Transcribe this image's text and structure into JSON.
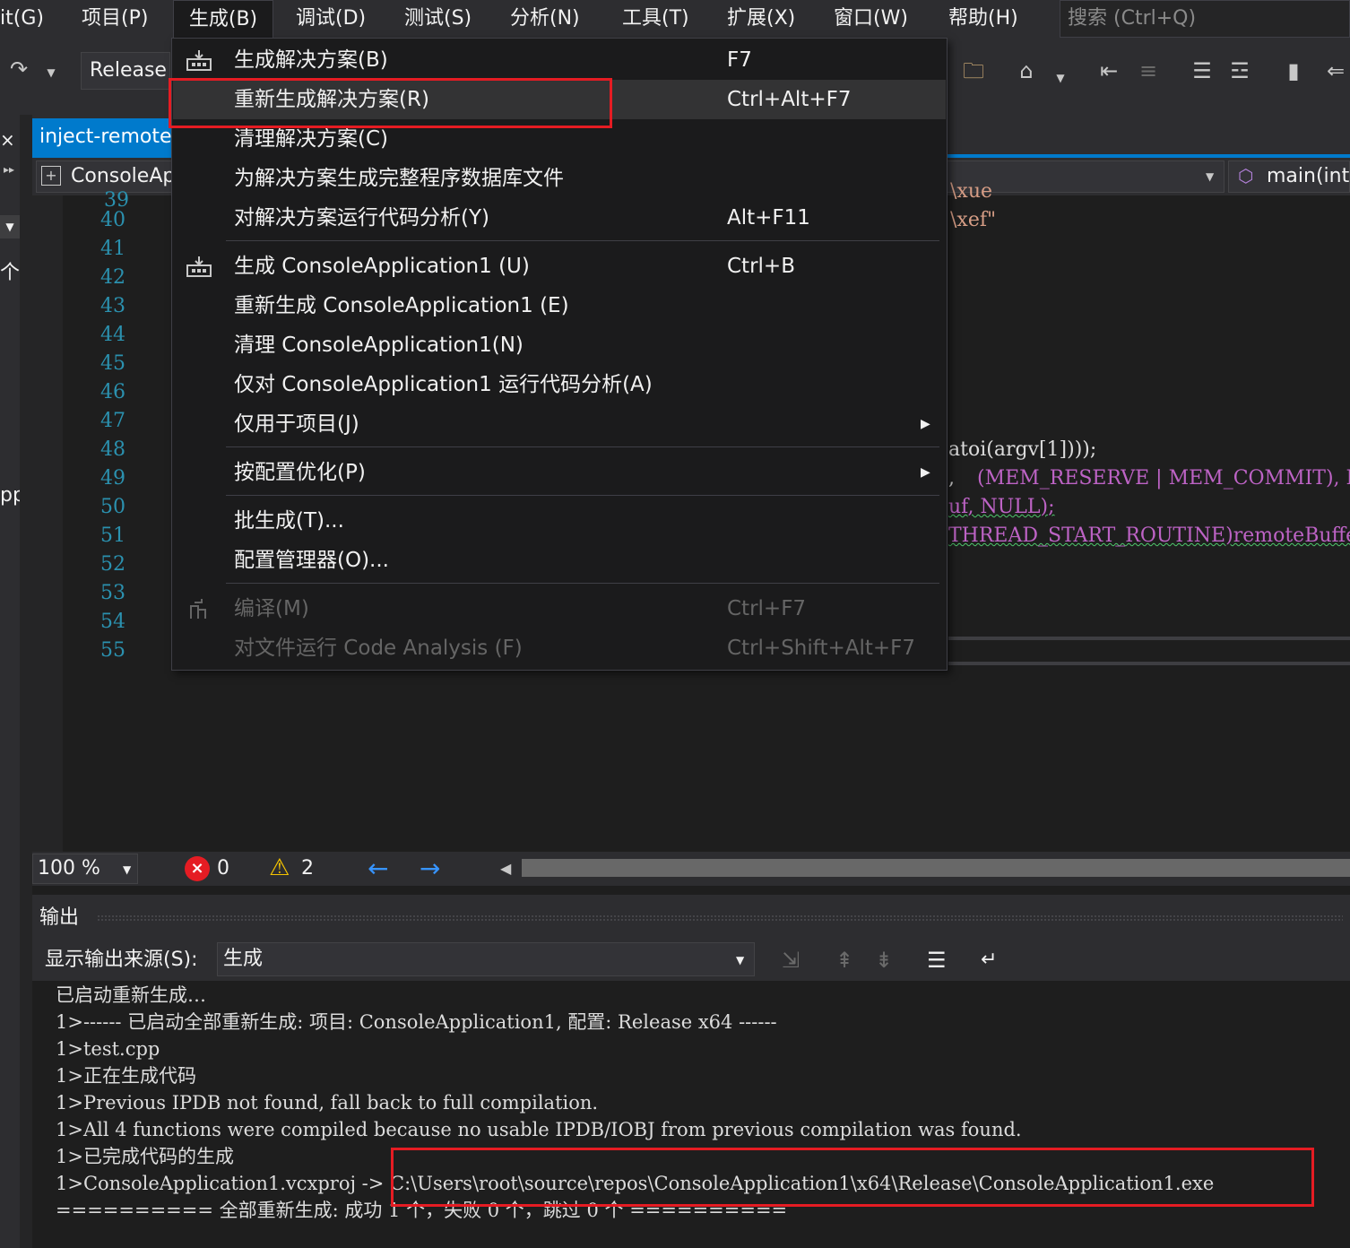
{
  "menubar": {
    "items": [
      "it(G)",
      "项目(P)",
      "生成(B)",
      "调试(D)",
      "测试(S)",
      "分析(N)",
      "工具(T)",
      "扩展(X)",
      "窗口(W)",
      "帮助(H)"
    ],
    "search_placeholder": "搜索 (Ctrl+Q)"
  },
  "toolbar": {
    "configuration": "Release"
  },
  "editor": {
    "tab_title": "inject-remote",
    "nav_project": "ConsoleAp",
    "nav_function": "main(int",
    "line_numbers": [
      "40",
      "41",
      "42",
      "43",
      "44",
      "45",
      "46",
      "47",
      "48",
      "49",
      "50",
      "51",
      "52",
      "53",
      "54",
      "55"
    ],
    "code_fragments": {
      "top_partial": "\\xue",
      "line40": "\\xef\"",
      "line48": "atoi(argv[1])));",
      "line49": "(MEM_RESERVE | MEM_COMMIT), PAGE_",
      "line49_lead": ",",
      "line50": "uf, NULL);",
      "line51": "THREAD_START_ROUTINE)remoteBuffer,"
    },
    "left_strip": [
      "个",
      "pp"
    ]
  },
  "status": {
    "zoom": "100 %",
    "errors": "0",
    "warnings": "2"
  },
  "output": {
    "title": "输出",
    "source_label": "显示输出来源(S):",
    "source_value": "生成",
    "lines": [
      "已启动重新生成…",
      "1>------ 已启动全部重新生成: 项目: ConsoleApplication1, 配置: Release x64 ------",
      "1>test.cpp",
      "1>正在生成代码",
      "1>Previous IPDB not found, fall back to full compilation.",
      "1>All 4 functions were compiled because no usable IPDB/IOBJ from previous compilation was found.",
      "1>已完成代码的生成",
      "1>ConsoleApplication1.vcxproj -> C:\\Users\\root\\source\\repos\\ConsoleApplication1\\x64\\Release\\ConsoleApplication1.exe",
      "========== 全部重新生成: 成功 1 个，失败 0 个，跳过 0 个 =========="
    ]
  },
  "build_menu": {
    "items": [
      {
        "label": "生成解决方案(B)",
        "shortcut": "F7"
      },
      {
        "label": "重新生成解决方案(R)",
        "shortcut": "Ctrl+Alt+F7"
      },
      {
        "label": "清理解决方案(C)",
        "shortcut": ""
      },
      {
        "label": "为解决方案生成完整程序数据库文件",
        "shortcut": ""
      },
      {
        "label": "对解决方案运行代码分析(Y)",
        "shortcut": "Alt+F11"
      },
      {
        "label": "生成 ConsoleApplication1 (U)",
        "shortcut": "Ctrl+B"
      },
      {
        "label": "重新生成 ConsoleApplication1 (E)",
        "shortcut": ""
      },
      {
        "label": "清理 ConsoleApplication1(N)",
        "shortcut": ""
      },
      {
        "label": "仅对 ConsoleApplication1 运行代码分析(A)",
        "shortcut": ""
      },
      {
        "label": "仅用于项目(J)",
        "shortcut": ""
      },
      {
        "label": "按配置优化(P)",
        "shortcut": ""
      },
      {
        "label": "批生成(T)...",
        "shortcut": ""
      },
      {
        "label": "配置管理器(O)...",
        "shortcut": ""
      },
      {
        "label": "编译(M)",
        "shortcut": "Ctrl+F7"
      },
      {
        "label": "对文件运行 Code Analysis (F)",
        "shortcut": "Ctrl+Shift+Alt+F7"
      }
    ]
  },
  "colors": {
    "accent": "#007acc",
    "highlight_box": "#e51c23",
    "menu_bg": "#1b1b1c",
    "line_number": "#2b91af"
  }
}
